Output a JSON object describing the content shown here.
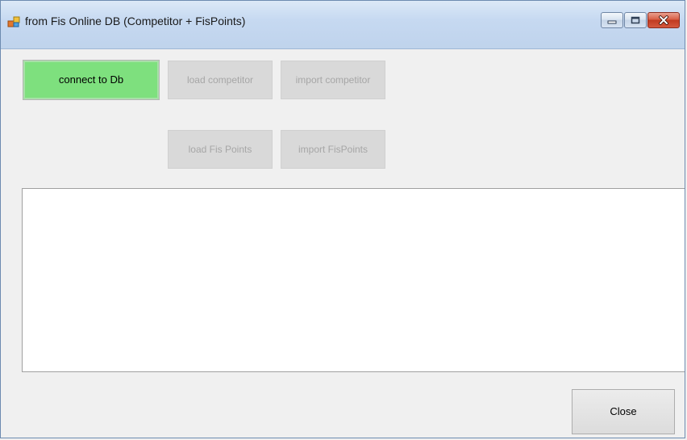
{
  "window": {
    "title": "from Fis Online DB (Competitor + FisPoints)",
    "icons": {
      "app": "app-window-icon",
      "minimize": "minimize-icon",
      "maximize": "maximize-icon",
      "close": "close-icon"
    }
  },
  "buttons": {
    "connect": "connect to Db",
    "load_competitor": "load competitor",
    "import_competitor": "import competitor",
    "load_fis_points": "load Fis Points",
    "import_fis_points": "import FisPoints",
    "close": "Close"
  },
  "log": {
    "text": ""
  },
  "colors": {
    "connect_button": "#7ee07e",
    "disabled_button": "#d9d9d9",
    "disabled_text": "#a6a6a6"
  }
}
